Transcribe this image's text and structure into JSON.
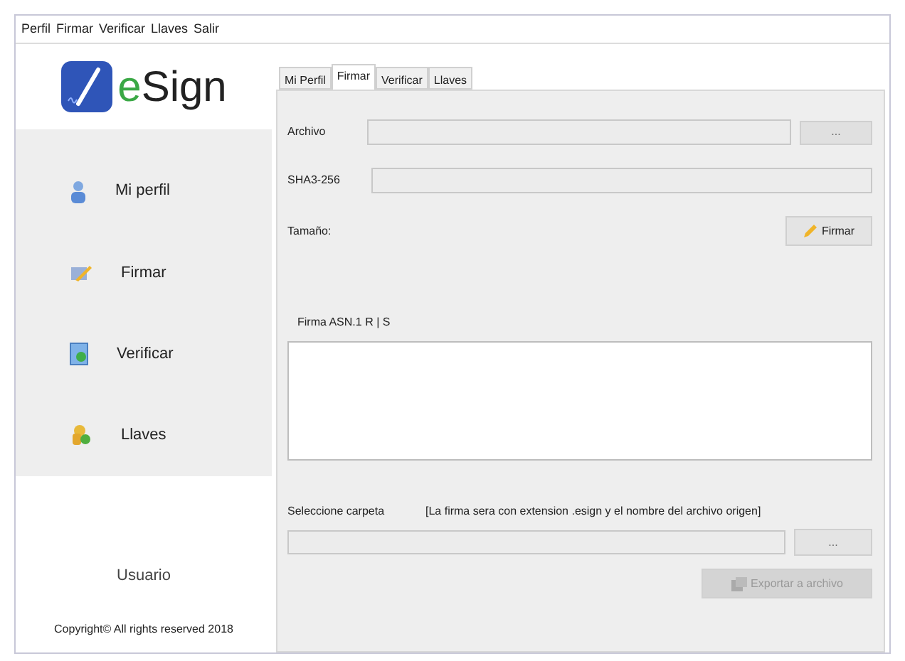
{
  "menu_bar": [
    "Perfil",
    "Firmar",
    "Verificar",
    "Llaves",
    "Salir"
  ],
  "logo": {
    "text": "eSign"
  },
  "sidebar": {
    "items": [
      {
        "label": "Mi perfil",
        "kind": "user",
        "selected": false
      },
      {
        "label": "Firmar",
        "kind": "sign",
        "selected": false
      },
      {
        "label": "Verificar",
        "kind": "verify",
        "selected": false
      },
      {
        "label": "Llaves",
        "kind": "keys",
        "selected": false
      }
    ],
    "user": "Usuario",
    "copyright": "Copyright© All rights reserved 2018"
  },
  "tabs": [
    {
      "label": "Mi Perfil",
      "selected": false
    },
    {
      "label": "Firmar",
      "selected": true
    },
    {
      "label": "Verificar",
      "selected": false
    },
    {
      "label": "Llaves",
      "selected": false
    }
  ],
  "form": {
    "archivo_label": "Archivo",
    "browse_button": "...",
    "sha_label": "SHA3-256",
    "size_label": "Tamaño:",
    "sign_button": "Firmar",
    "signature_label": "Firma ASN.1 R | S",
    "folder_label": "Seleccione carpeta",
    "folder_note": "[La firma sera con extension .esign y el nombre del archivo origen]",
    "folder_browse_button": "...",
    "export_button": {
      "label": "Exportar a archivo",
      "disabled": true
    }
  }
}
